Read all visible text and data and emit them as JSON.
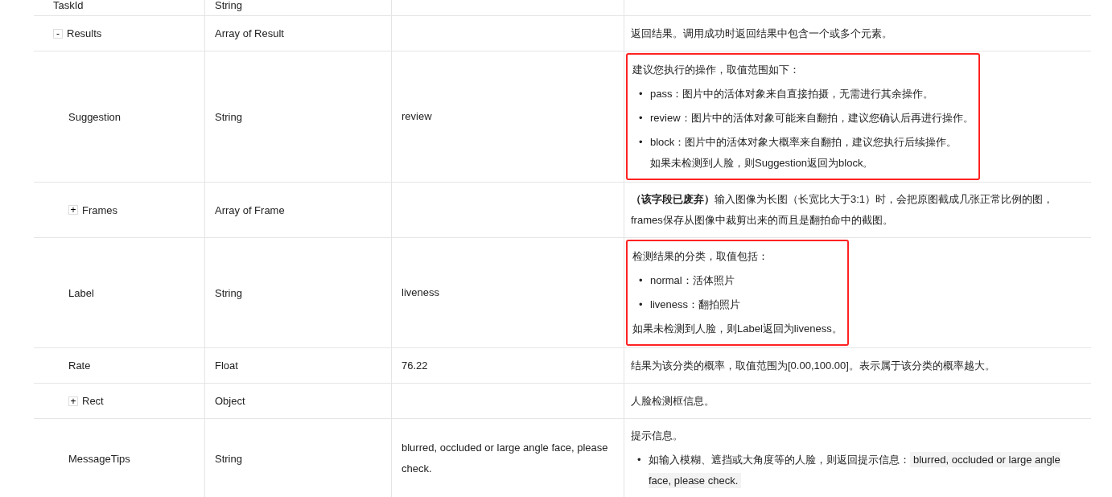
{
  "table": {
    "rows": [
      {
        "name": "TaskId",
        "type": "String"
      },
      {
        "name": "Results",
        "type": "Array of Result",
        "toggle": "-",
        "description": [
          {
            "kind": "para",
            "text": "返回结果。调用成功时返回结果中包含一个或多个元素。"
          }
        ],
        "children": [
          {
            "name": "Suggestion",
            "type": "String",
            "example": "review",
            "highlighted": true,
            "description": [
              {
                "kind": "para",
                "text": "建议您执行的操作，取值范围如下："
              },
              {
                "kind": "bullet",
                "marker": "•",
                "text": "pass：图片中的活体对象来自直接拍摄，无需进行其余操作。"
              },
              {
                "kind": "bullet",
                "marker": "•",
                "text": "review：图片中的活体对象可能来自翻拍，建议您确认后再进行操作。"
              },
              {
                "kind": "bullet",
                "marker": "•",
                "text": "block：图片中的活体对象大概率来自翻拍，建议您执行后续操作。",
                "note": "如果未检测到人脸，则Suggestion返回为block。"
              }
            ]
          },
          {
            "name": "Frames",
            "type": "Array of Frame",
            "toggle": "+",
            "description": [
              {
                "kind": "para",
                "text": "**（该字段已废弃）**输入图像为长图（长宽比大于3:1）时，会把原图截成几张正常比例的图，frames保存从图像中裁剪出来的而且是翻拍命中的截图。"
              }
            ]
          },
          {
            "name": "Label",
            "type": "String",
            "example": "liveness",
            "highlighted": true,
            "description": [
              {
                "kind": "para",
                "text": "检测结果的分类，取值包括："
              },
              {
                "kind": "bullet",
                "marker": "•",
                "text": "normal：活体照片"
              },
              {
                "kind": "bullet",
                "marker": "•",
                "text": "liveness：翻拍照片"
              },
              {
                "kind": "para",
                "text": "如果未检测到人脸，则Label返回为liveness。"
              }
            ]
          },
          {
            "name": "Rate",
            "type": "Float",
            "example": "76.22",
            "description": [
              {
                "kind": "para",
                "text": "结果为该分类的概率，取值范围为[0.00,100.00]。表示属于该分类的概率越大。"
              }
            ]
          },
          {
            "name": "Rect",
            "type": "Object",
            "toggle": "+",
            "description": [
              {
                "kind": "para",
                "text": "人脸检测框信息。"
              }
            ]
          },
          {
            "name": "MessageTips",
            "type": "String",
            "example": "blurred, occluded or large angle face, please check.",
            "description": [
              {
                "kind": "para",
                "text": "提示信息。"
              },
              {
                "kind": "bullet",
                "marker": "•",
                "text": "如输入模糊、遮挡或大角度等的人脸，则返回提示信息：",
                "code": "blurred, occluded or large angle face, please check."
              }
            ]
          }
        ]
      }
    ]
  }
}
